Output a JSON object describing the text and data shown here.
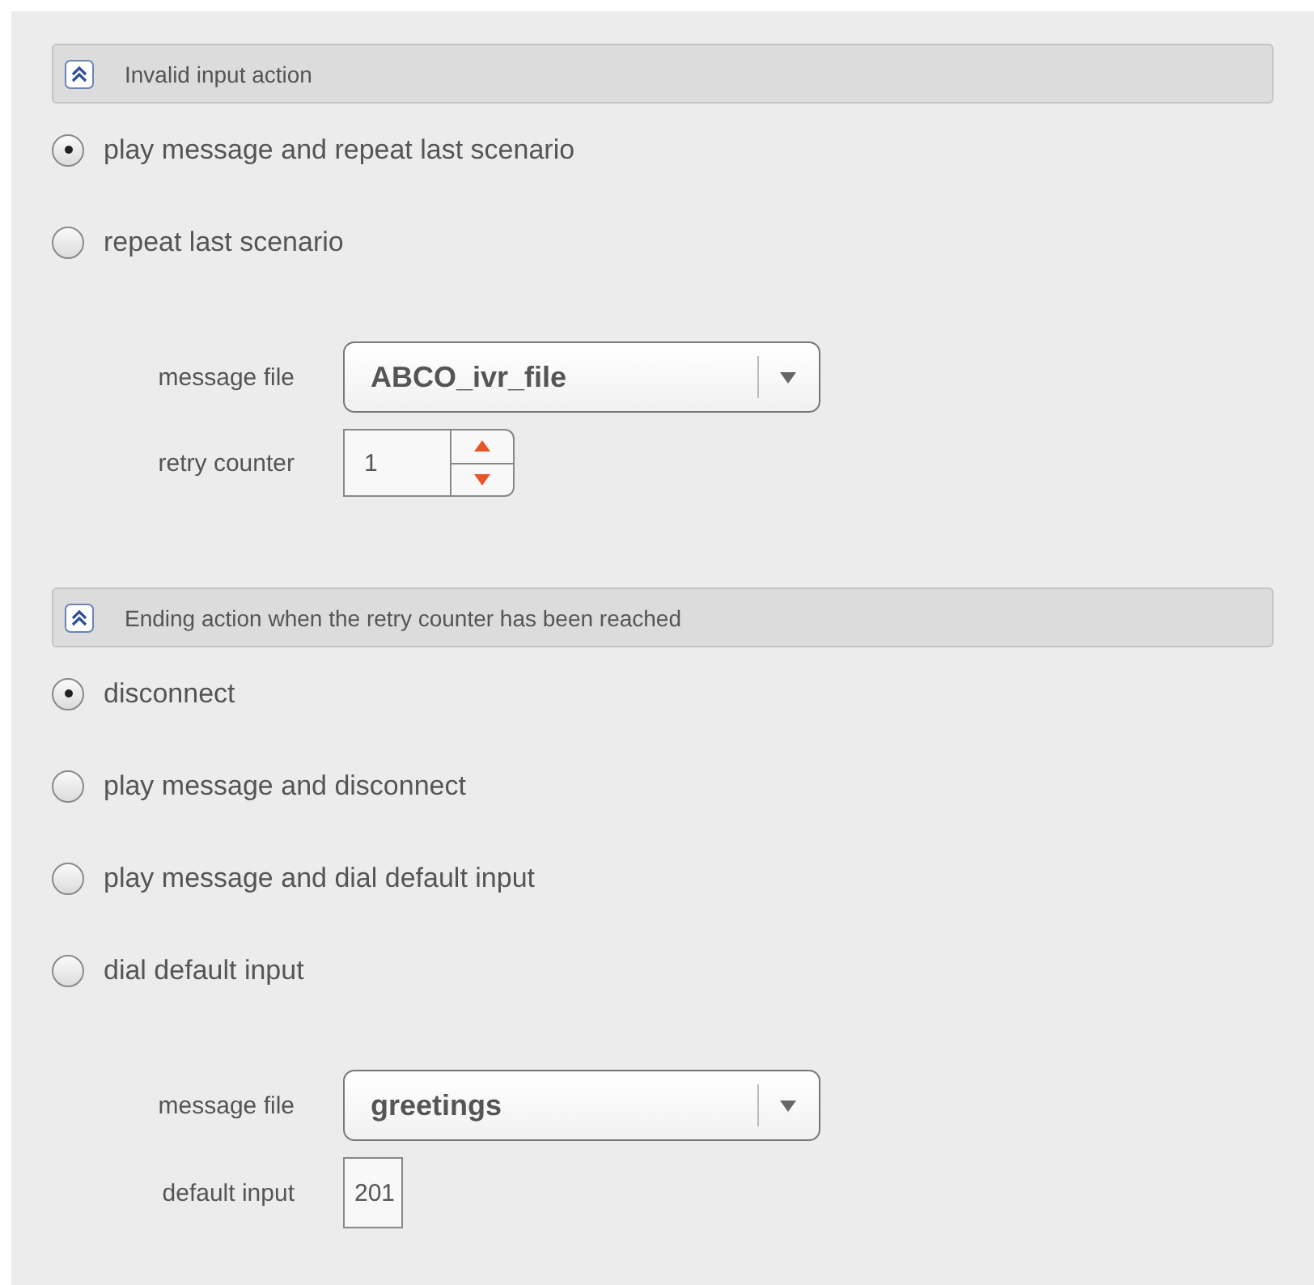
{
  "sections": [
    {
      "title": "Invalid input action",
      "options": [
        {
          "label": "play message and repeat last scenario",
          "selected": true
        },
        {
          "label": "repeat last scenario",
          "selected": false
        }
      ],
      "fields": [
        {
          "kind": "dropdown",
          "label": "message file",
          "value": "ABCO_ivr_file"
        },
        {
          "kind": "spinner",
          "label": "retry counter",
          "value": "1"
        }
      ]
    },
    {
      "title": "Ending action when the retry counter has been reached",
      "options": [
        {
          "label": "disconnect",
          "selected": true
        },
        {
          "label": "play message and disconnect",
          "selected": false
        },
        {
          "label": "play message and dial default input",
          "selected": false
        },
        {
          "label": "dial default input",
          "selected": false
        }
      ],
      "fields": [
        {
          "kind": "dropdown",
          "label": "message file",
          "value": "greetings"
        },
        {
          "kind": "text",
          "label": "default input",
          "value": "201"
        }
      ]
    }
  ]
}
